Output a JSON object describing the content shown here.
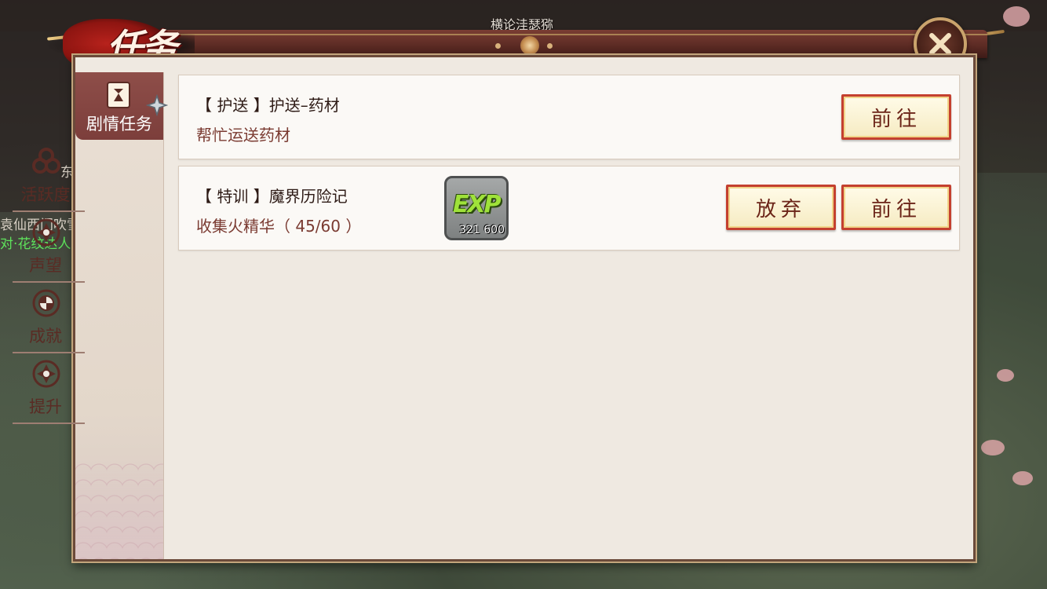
{
  "window": {
    "title": "任务",
    "top_label": "横论洼瑟猕"
  },
  "background": {
    "text_left_1": "东",
    "text_left_2": "袁仙西门吹雪",
    "text_left_3": "对·花纹达人"
  },
  "sidebar": {
    "items": [
      {
        "label": "剧情任务",
        "icon": "story-scroll-icon",
        "active": true
      },
      {
        "label": "活跃度",
        "icon": "activity-clover-icon",
        "active": false
      },
      {
        "label": "声望",
        "icon": "reputation-emblem-icon",
        "active": false
      },
      {
        "label": "成就",
        "icon": "achievement-emblem-icon",
        "active": false
      },
      {
        "label": "提升",
        "icon": "upgrade-emblem-icon",
        "active": false
      }
    ]
  },
  "quests": [
    {
      "title": "【 护送 】护送–药材",
      "desc": "帮忙运送药材",
      "go_label": "前往"
    },
    {
      "title": "【 特训 】魔界历险记",
      "desc": "收集火精华（ 45/60 ）",
      "reward_label": "EXP",
      "reward_amount": "321 600",
      "abandon_label": "放弃",
      "go_label": "前往"
    }
  ],
  "colors": {
    "accent_red": "#c4402f",
    "panel_bg": "#efe9e1",
    "sidebar_active": "#8e4e49"
  }
}
